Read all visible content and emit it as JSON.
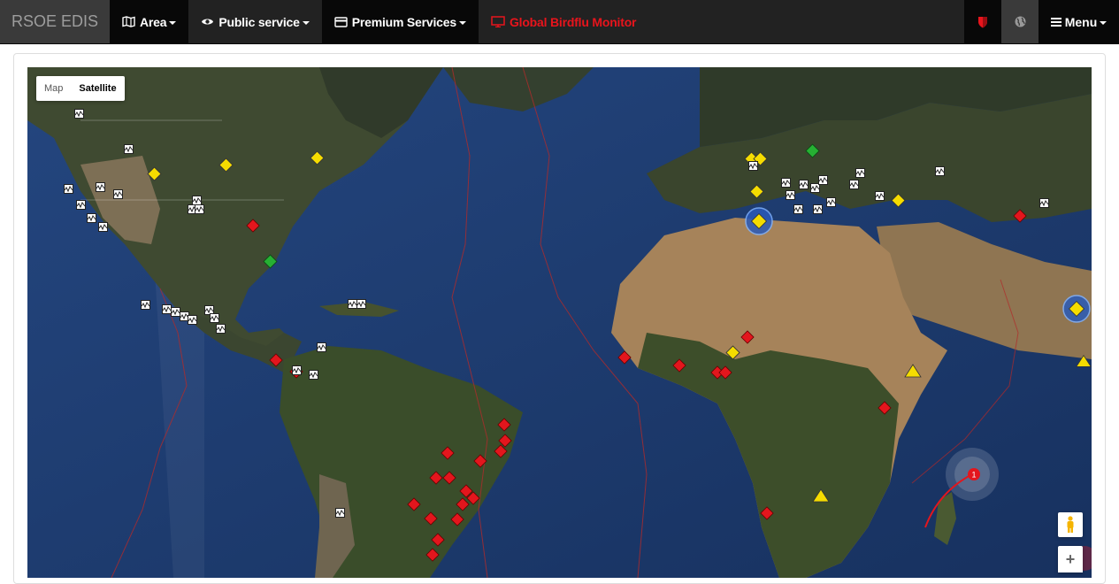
{
  "navbar": {
    "brand": "RSOE EDIS",
    "items": [
      {
        "label": "Area",
        "icon": "map-icon"
      },
      {
        "label": "Public service",
        "icon": "eye-icon"
      },
      {
        "label": "Premium Services",
        "icon": "card-icon"
      }
    ],
    "highlight": {
      "label": "Global Birdflu Monitor",
      "icon": "monitor-icon",
      "color": "#e8141c"
    },
    "menu_label": "Menu"
  },
  "map": {
    "type_buttons": [
      "Map",
      "Satellite"
    ],
    "active_type": "Satellite",
    "zoom_in": "+"
  },
  "colors": {
    "danger": "#e3161d",
    "warning": "#f5dc00",
    "ok": "#26b033",
    "ocean": "#1e3b6e"
  }
}
